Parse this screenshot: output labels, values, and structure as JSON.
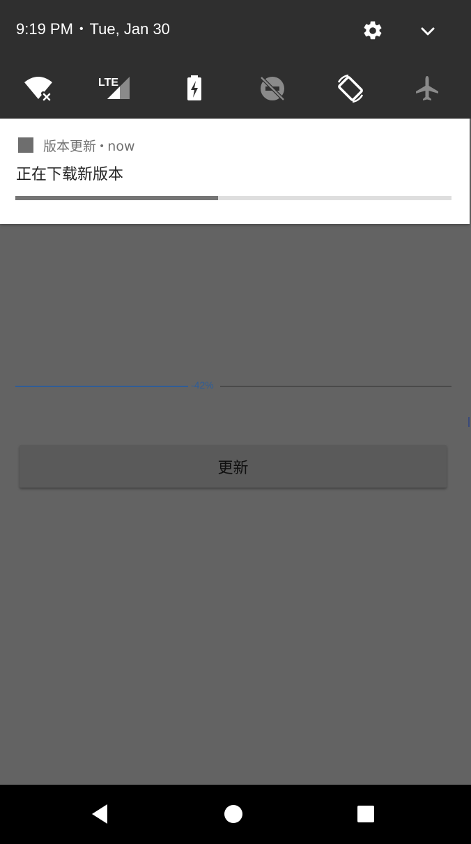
{
  "status_bar": {
    "time": "9:19 PM",
    "separator": "•",
    "date": "Tue, Jan 30"
  },
  "quick_settings": {
    "tiles": [
      {
        "icon": "wifi-off-icon",
        "label": ""
      },
      {
        "icon": "lte-signal-icon",
        "label": "LTE"
      },
      {
        "icon": "battery-saver-icon",
        "label": ""
      },
      {
        "icon": "do-not-disturb-off-icon",
        "label": ""
      },
      {
        "icon": "auto-rotate-icon",
        "label": ""
      },
      {
        "icon": "airplane-mode-icon",
        "label": ""
      }
    ]
  },
  "notification": {
    "app_name": "版本更新",
    "separator": "•",
    "time": "now",
    "title": "正在下载新版本",
    "progress": 0.465
  },
  "app": {
    "progress_label": "-42%",
    "progress": 0.42,
    "update_button_label": "更新"
  },
  "navigation": {
    "back": "back-icon",
    "home": "home-icon",
    "recents": "recents-icon"
  },
  "colors": {
    "shade_background": "#2f2f2f",
    "scrim": "#636363",
    "accent_blue": "#2f5d97",
    "notification_background": "#ffffff"
  }
}
